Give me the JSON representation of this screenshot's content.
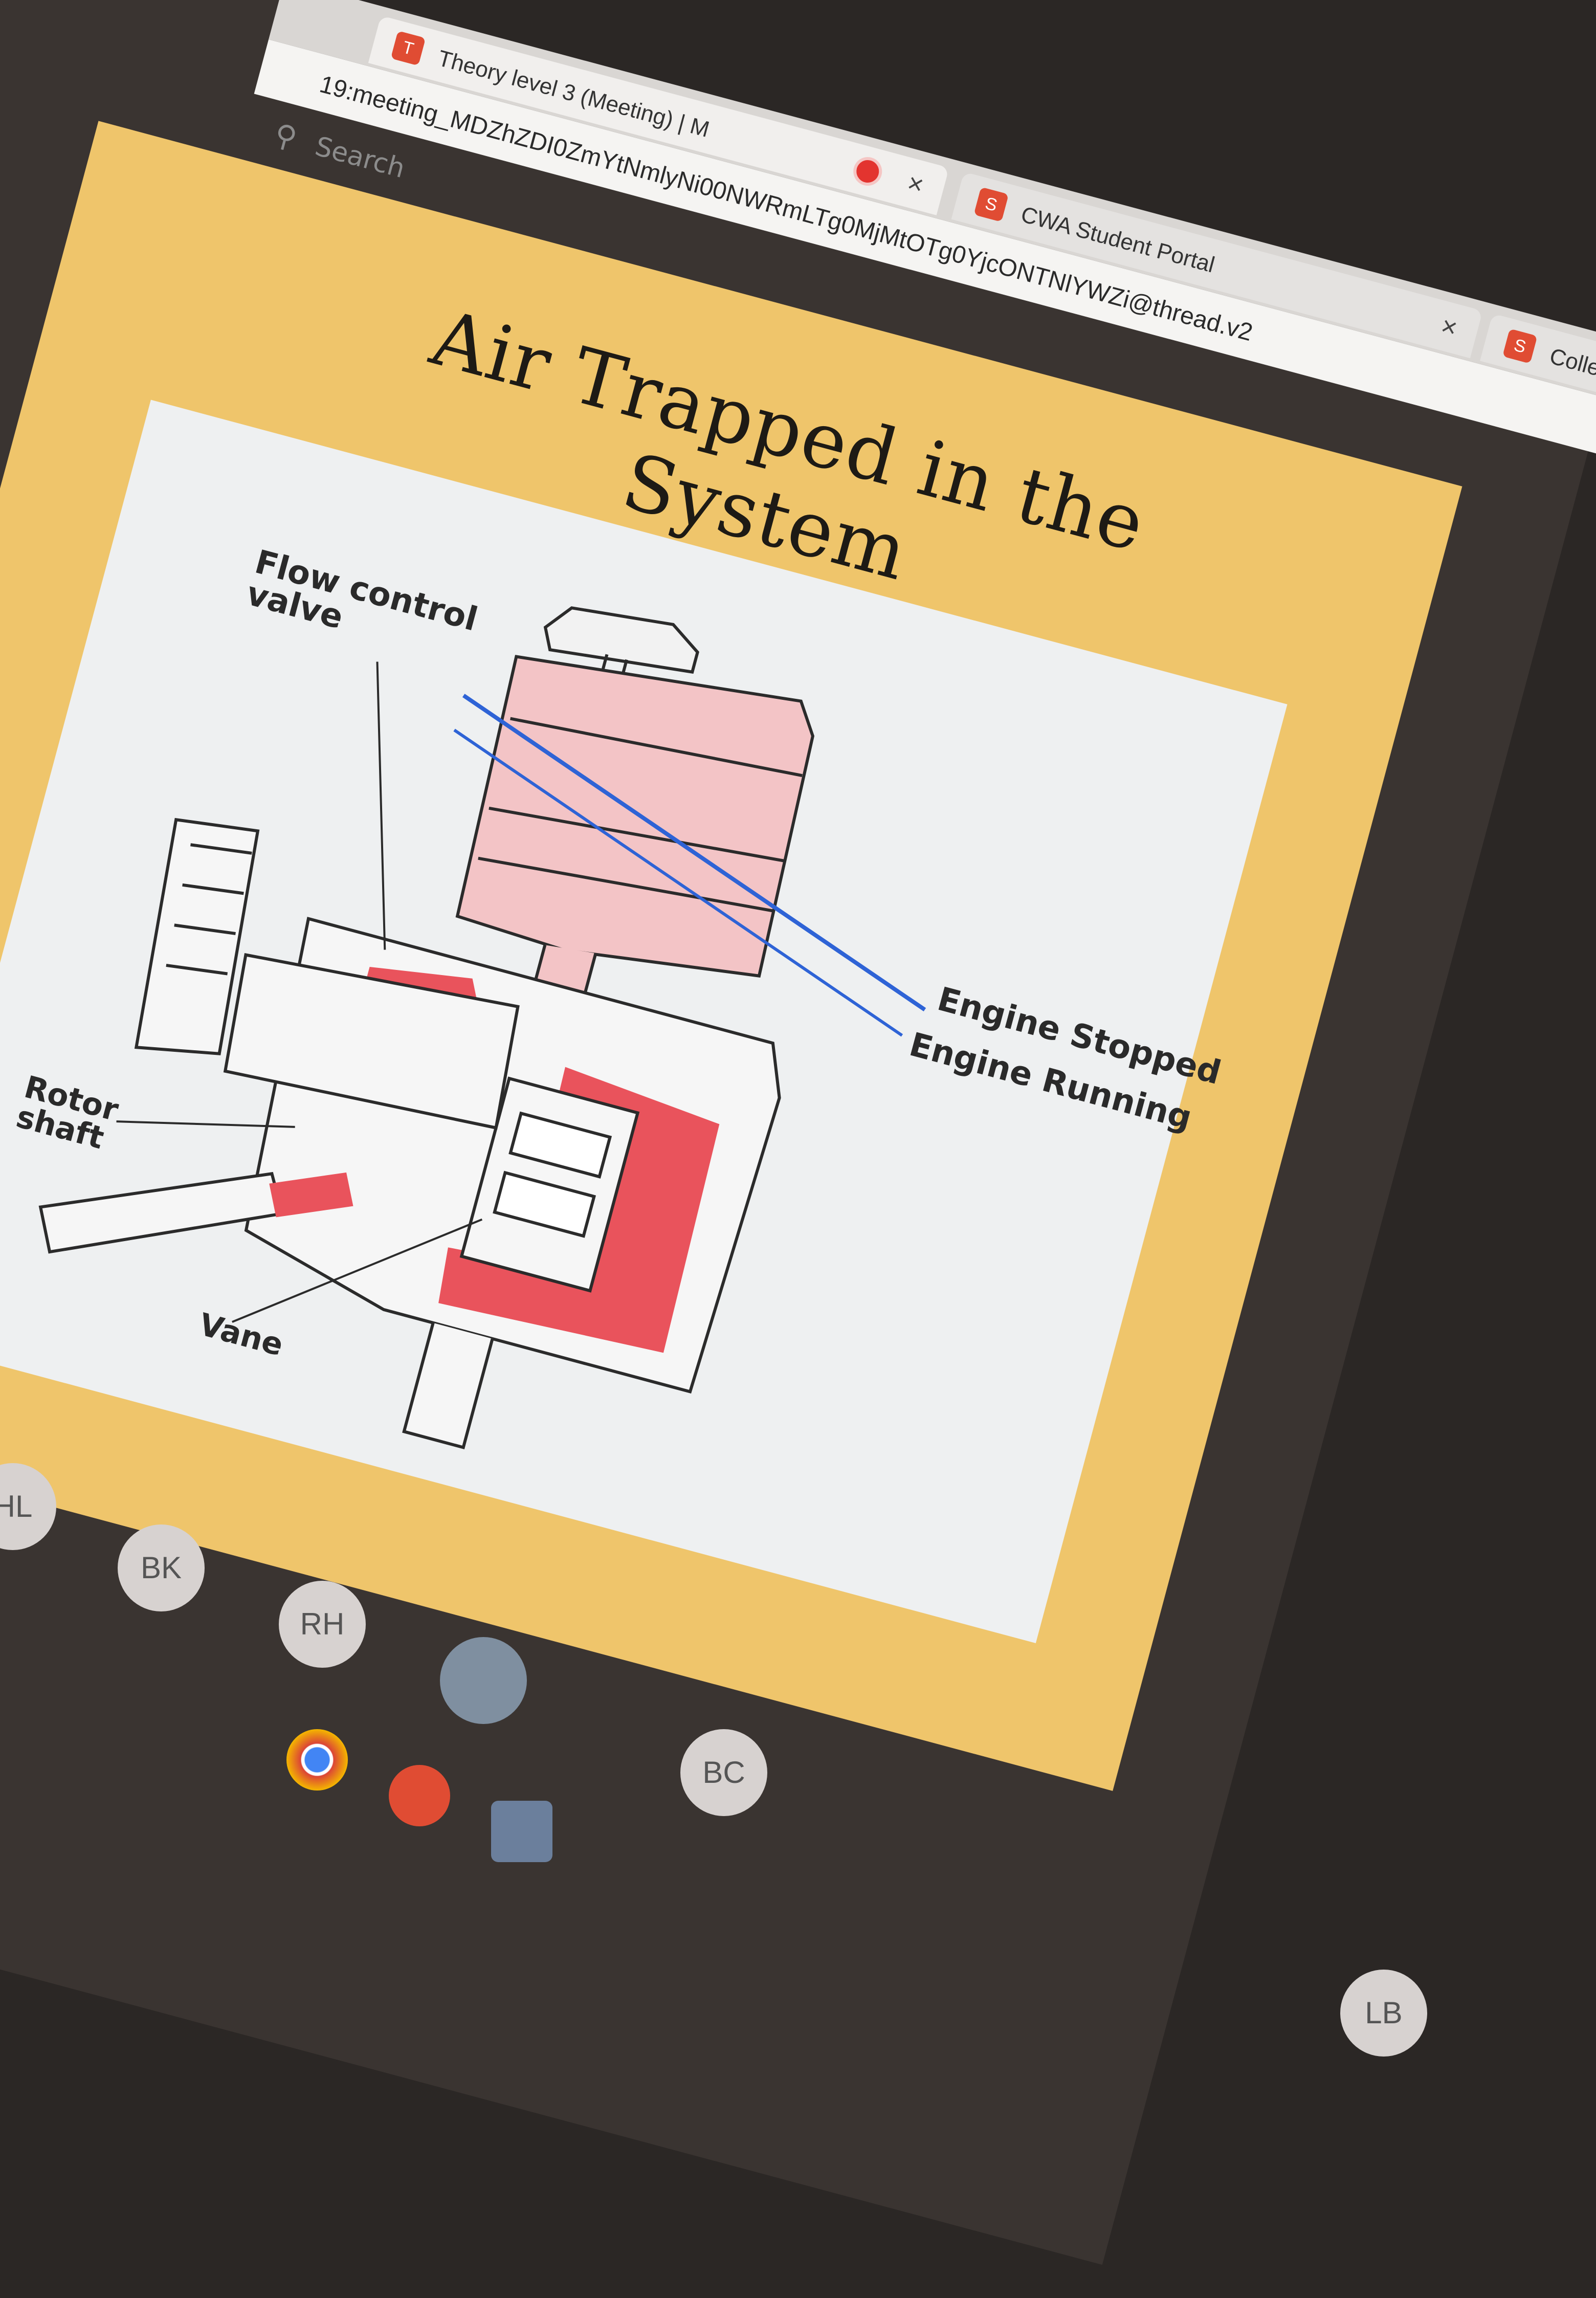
{
  "browser": {
    "tabs": [
      {
        "label": "Theory level 3 (Meeting) | M",
        "recording": true,
        "close": "×"
      },
      {
        "label": "CWA Student Portal",
        "close": "×"
      },
      {
        "label": "College"
      }
    ],
    "url": "19:meeting_MDZhZDI0ZmYtNmlyNi00NWRmLTg0MjMtOTg0YjcONTNlYWZi@thread.v2",
    "search_placeholder": "Search"
  },
  "slide": {
    "title": "Air Trapped in the System",
    "labels": {
      "flow_control_valve": "Flow control\nvalve",
      "engine_stopped": "Engine Stopped",
      "engine_running": "Engine Running",
      "rotor_shaft": "Rotor\nshaft",
      "vane": "Vane"
    },
    "colors": {
      "fluid_light": "#f3c4c6",
      "fluid_dark": "#e9535c",
      "level_line": "#2e63d6",
      "slide_bg": "#efc56b"
    }
  },
  "participants": [
    "HL",
    "BK",
    "RH",
    "BC",
    "LB"
  ]
}
